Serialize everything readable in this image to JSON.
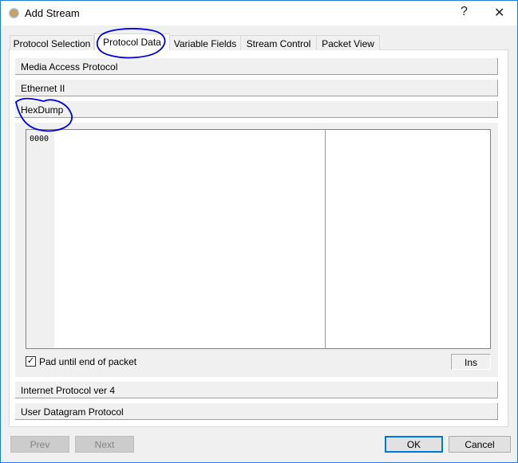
{
  "window": {
    "title": "Add Stream",
    "help_label": "?",
    "close_label": "✕",
    "icon": "gear-icon"
  },
  "tabs": [
    {
      "label": "Protocol Selection"
    },
    {
      "label": "Protocol Data",
      "active": true
    },
    {
      "label": "Variable Fields"
    },
    {
      "label": "Stream Control"
    },
    {
      "label": "Packet View"
    }
  ],
  "sections": {
    "mac": "Media Access Protocol",
    "eth": "Ethernet II",
    "hexdump": "HexDump",
    "ipv4": "Internet Protocol ver 4",
    "udp": "User Datagram Protocol"
  },
  "hexdump": {
    "address": "0000",
    "pad_label": "Pad until end of packet",
    "pad_checked": true,
    "mode": "Ins"
  },
  "buttons": {
    "prev": "Prev",
    "next": "Next",
    "ok": "OK",
    "cancel": "Cancel"
  },
  "colors": {
    "annotation": "#0000e0",
    "accent": "#0078d7"
  }
}
